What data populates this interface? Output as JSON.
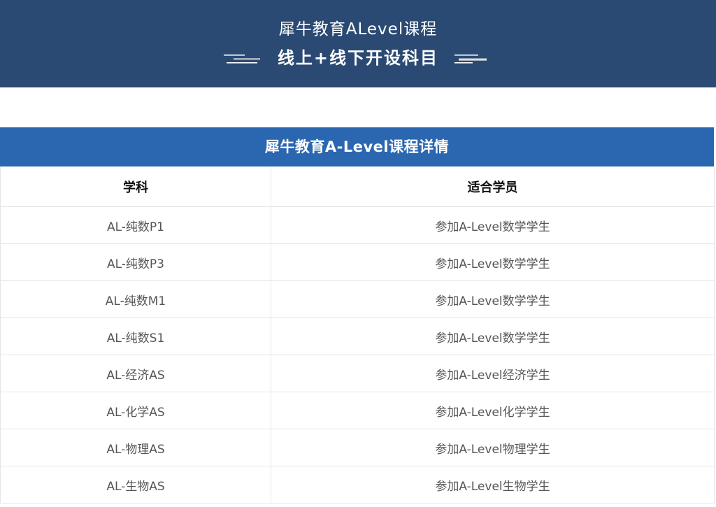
{
  "banner": {
    "title": "犀牛教育ALevel课程",
    "subtitle": "线上+线下开设科目"
  },
  "table": {
    "header": "犀牛教育A-Level课程详情",
    "columns": [
      "学科",
      "适合学员"
    ],
    "rows": [
      {
        "subject": "AL-纯数P1",
        "students": "参加A-Level数学学生"
      },
      {
        "subject": "AL-纯数P3",
        "students": "参加A-Level数学学生"
      },
      {
        "subject": "AL-纯数M1",
        "students": "参加A-Level数学学生"
      },
      {
        "subject": "AL-纯数S1",
        "students": "参加A-Level数学学生"
      },
      {
        "subject": "AL-经济AS",
        "students": "参加A-Level经济学生"
      },
      {
        "subject": "AL-化学AS",
        "students": "参加A-Level化学学生"
      },
      {
        "subject": "AL-物理AS",
        "students": "参加A-Level物理学生"
      },
      {
        "subject": "AL-生物AS",
        "students": "参加A-Level生物学生"
      }
    ]
  },
  "colors": {
    "banner_bg": "#2a4a73",
    "table_header_bg": "#2b67b0",
    "grid_line": "#e3e6ea"
  }
}
